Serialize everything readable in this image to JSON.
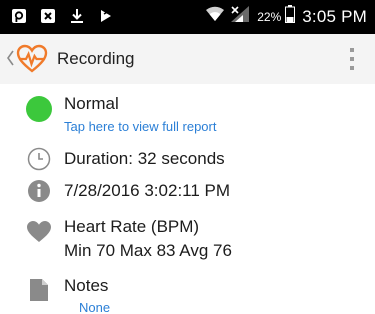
{
  "status_bar": {
    "battery_percent": "22%",
    "time": "3:05 PM",
    "icons": [
      "notification-app-icon",
      "close-box-icon",
      "download-icon",
      "media-icon",
      "wifi-icon",
      "signal-icon",
      "battery-icon"
    ]
  },
  "action_bar": {
    "title": "Recording",
    "logo_icon": "heart-pulse-logo",
    "back_icon": "chevron-left-icon",
    "menu_icon": "overflow-menu-icon"
  },
  "details": {
    "status": {
      "label": "Normal",
      "link": "Tap here to view full report",
      "color": "#3cc83c"
    },
    "duration": "Duration: 32 seconds",
    "datetime": "7/28/2016 3:02:11 PM",
    "heart_rate": {
      "label": "Heart Rate (BPM)",
      "values": "Min 70 Max 83 Avg 76"
    },
    "notes": {
      "label": "Notes",
      "value": "None"
    }
  },
  "colors": {
    "link": "#2b7fd6",
    "icon_gray": "#8a8a8a",
    "logo_orange": "#f07a2a"
  }
}
